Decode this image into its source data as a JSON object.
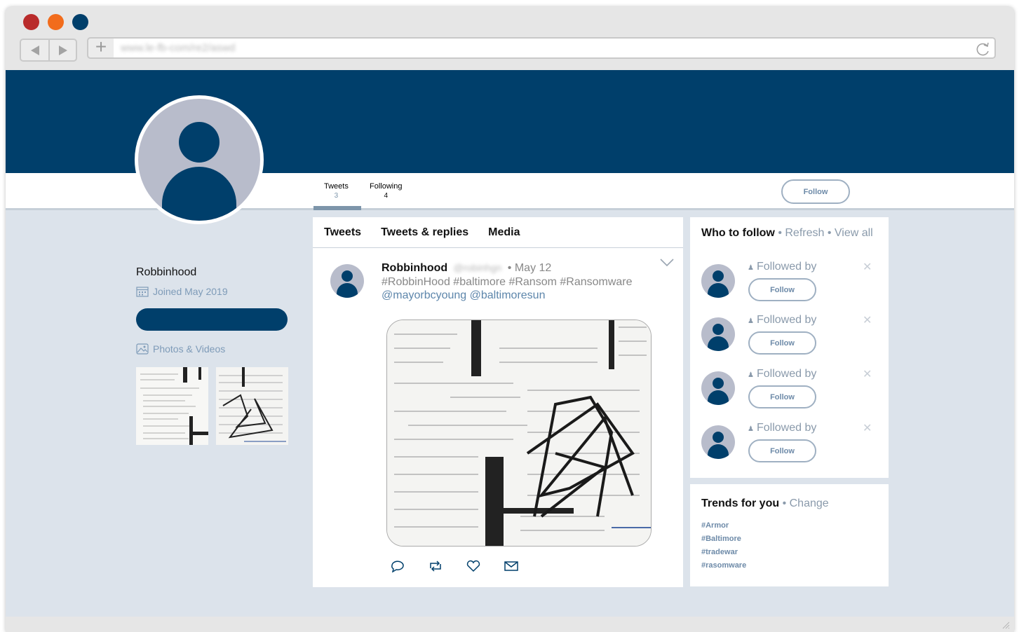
{
  "browser": {
    "window_dots": [
      "#b92b2b",
      "#f26c1c",
      "#003f6b"
    ],
    "url": "www.le-fb-com/re2/aswd",
    "back_icon": "back-arrow-icon",
    "forward_icon": "forward-arrow-icon",
    "new_tab_label": "+",
    "reload_icon": "reload-icon"
  },
  "profile": {
    "name": "Robbinhood",
    "joined": "Joined May 2019",
    "photos_link": "Photos & Videos",
    "stats": [
      {
        "label": "Tweets",
        "value": "3"
      },
      {
        "label": "Following",
        "value": "4"
      }
    ],
    "follow_label": "Follow"
  },
  "timeline": {
    "tabs": [
      "Tweets",
      "Tweets & replies",
      "Media"
    ],
    "tweet": {
      "name": "Robbinhood",
      "handle": "@robinhgn",
      "date": "• May 12",
      "hashtags": "#RobbinHood #baltimore #Ransom #Ransomware",
      "mentions": "@mayorbcyoung @baltimoresun",
      "actions": [
        "reply-icon",
        "retweet-icon",
        "like-icon",
        "message-icon"
      ]
    }
  },
  "who_to_follow": {
    "title": "Who to follow",
    "refresh": "• Refresh",
    "view_all": "• View all",
    "rows": [
      {
        "followed_by": "Followed by",
        "follow_label": "Follow",
        "dismiss": "✕"
      },
      {
        "followed_by": "Followed by",
        "follow_label": "Follow",
        "dismiss": "✕"
      },
      {
        "followed_by": "Followed by",
        "follow_label": "Follow",
        "dismiss": "✕"
      },
      {
        "followed_by": "Followed by",
        "follow_label": "Follow",
        "dismiss": "✕"
      }
    ]
  },
  "trends": {
    "title": "Trends for you",
    "change": "• Change",
    "items": [
      "#Armor",
      "#Baltimore",
      "#tradewar",
      "#rasomware"
    ]
  }
}
